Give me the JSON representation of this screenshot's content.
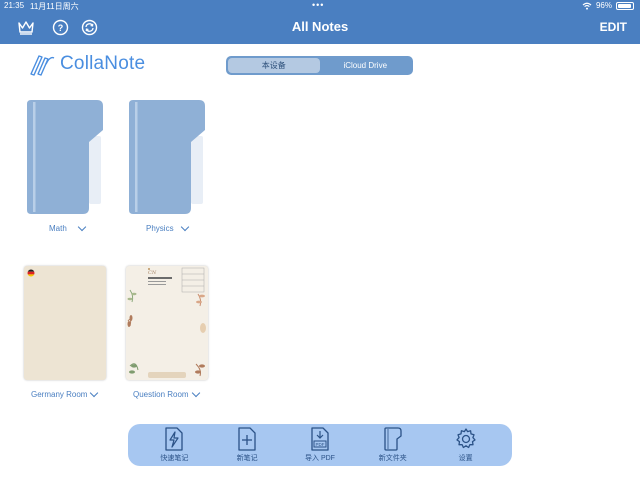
{
  "status": {
    "time": "21:35",
    "date": "11月11日周六",
    "battery": "96%"
  },
  "nav": {
    "title": "All Notes",
    "edit_label": "EDIT"
  },
  "logo": {
    "text": "CollaNote"
  },
  "segment": {
    "options": [
      "本设备",
      "iCloud Drive"
    ],
    "selected": "本设备"
  },
  "folders": [
    {
      "name": "Math"
    },
    {
      "name": "Physics"
    }
  ],
  "notes": [
    {
      "name": "Germany Room"
    },
    {
      "name": "Question Room"
    }
  ],
  "toolbar": {
    "items": [
      {
        "label": "快速笔记",
        "icon": "lightning-doc-icon"
      },
      {
        "label": "新笔记",
        "icon": "new-note-icon"
      },
      {
        "label": "导入 PDF",
        "icon": "pdf-import-icon"
      },
      {
        "label": "新文件夹",
        "icon": "new-folder-icon"
      },
      {
        "label": "设置",
        "icon": "gear-icon"
      }
    ]
  },
  "colors": {
    "nav_blue": "#4a7fc1",
    "folder_blue": "#8fb0d6",
    "toolbar_bg": "#a7c7f1",
    "logo_blue": "#4a8ee0"
  }
}
